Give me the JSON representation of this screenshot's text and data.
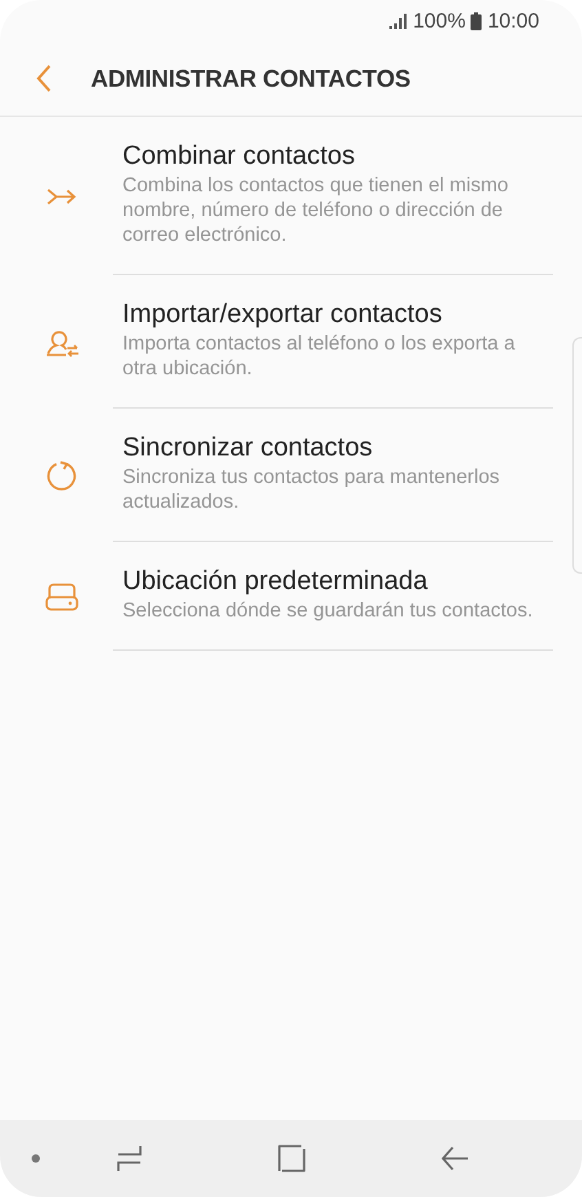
{
  "status_bar": {
    "battery": "100%",
    "time": "10:00"
  },
  "header": {
    "title": "ADMINISTRAR CONTACTOS"
  },
  "items": [
    {
      "kind": "merge",
      "title": "Combinar contactos",
      "subtitle": "Combina los contactos que tienen el mismo nombre, número de teléfono o dirección de correo electrónico."
    },
    {
      "kind": "import",
      "title": "Importar/exportar contactos",
      "subtitle": "Importa contactos al teléfono o los exporta a otra ubicación."
    },
    {
      "kind": "sync",
      "title": "Sincronizar contactos",
      "subtitle": "Sincroniza tus contactos para mantenerlos actualizados."
    },
    {
      "kind": "storage",
      "title": "Ubicación predeterminada",
      "subtitle": "Selecciona dónde se guardarán tus contactos."
    }
  ]
}
